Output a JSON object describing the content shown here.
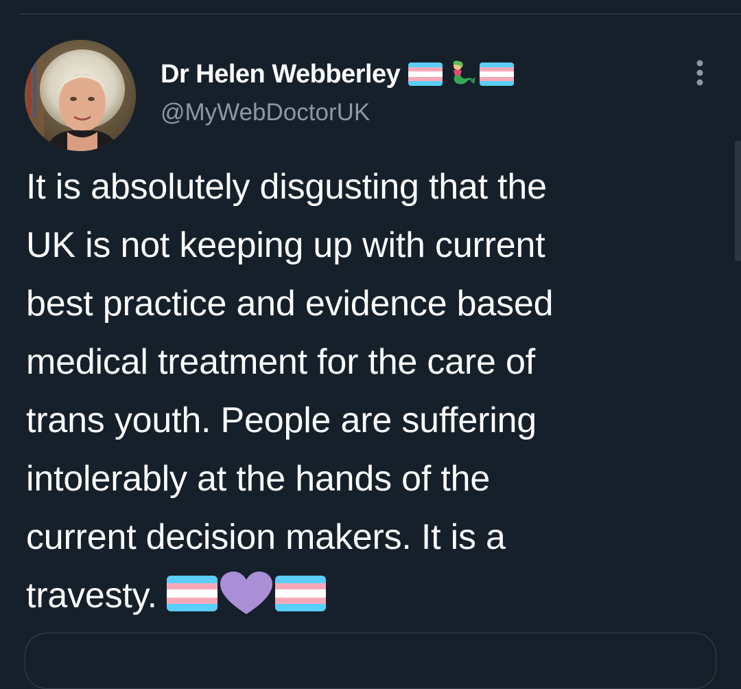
{
  "tweet": {
    "display_name": "Dr Helen Webberley",
    "name_emoji": [
      "transgender-flag",
      "merperson",
      "transgender-flag"
    ],
    "handle": "@MyWebDoctorUK",
    "text": "It is absolutely disgusting that the\nUK is not keeping up with current\nbest practice and evidence based\nmedical treatment for the care of\ntrans youth. People are suffering\nintolerably at the hands of the\ncurrent decision makers. It is a\ntravesty.",
    "text_emoji": [
      "transgender-flag",
      "purple-heart",
      "transgender-flag"
    ]
  },
  "colors": {
    "background": "#15202b",
    "text_primary": "#ffffff",
    "text_secondary": "#8b98a5",
    "divider": "#38444d",
    "flag_blue": "#5bcefa",
    "flag_pink": "#f5a9b8",
    "flag_white": "#ffffff",
    "heart_purple": "#aa8ed6"
  }
}
